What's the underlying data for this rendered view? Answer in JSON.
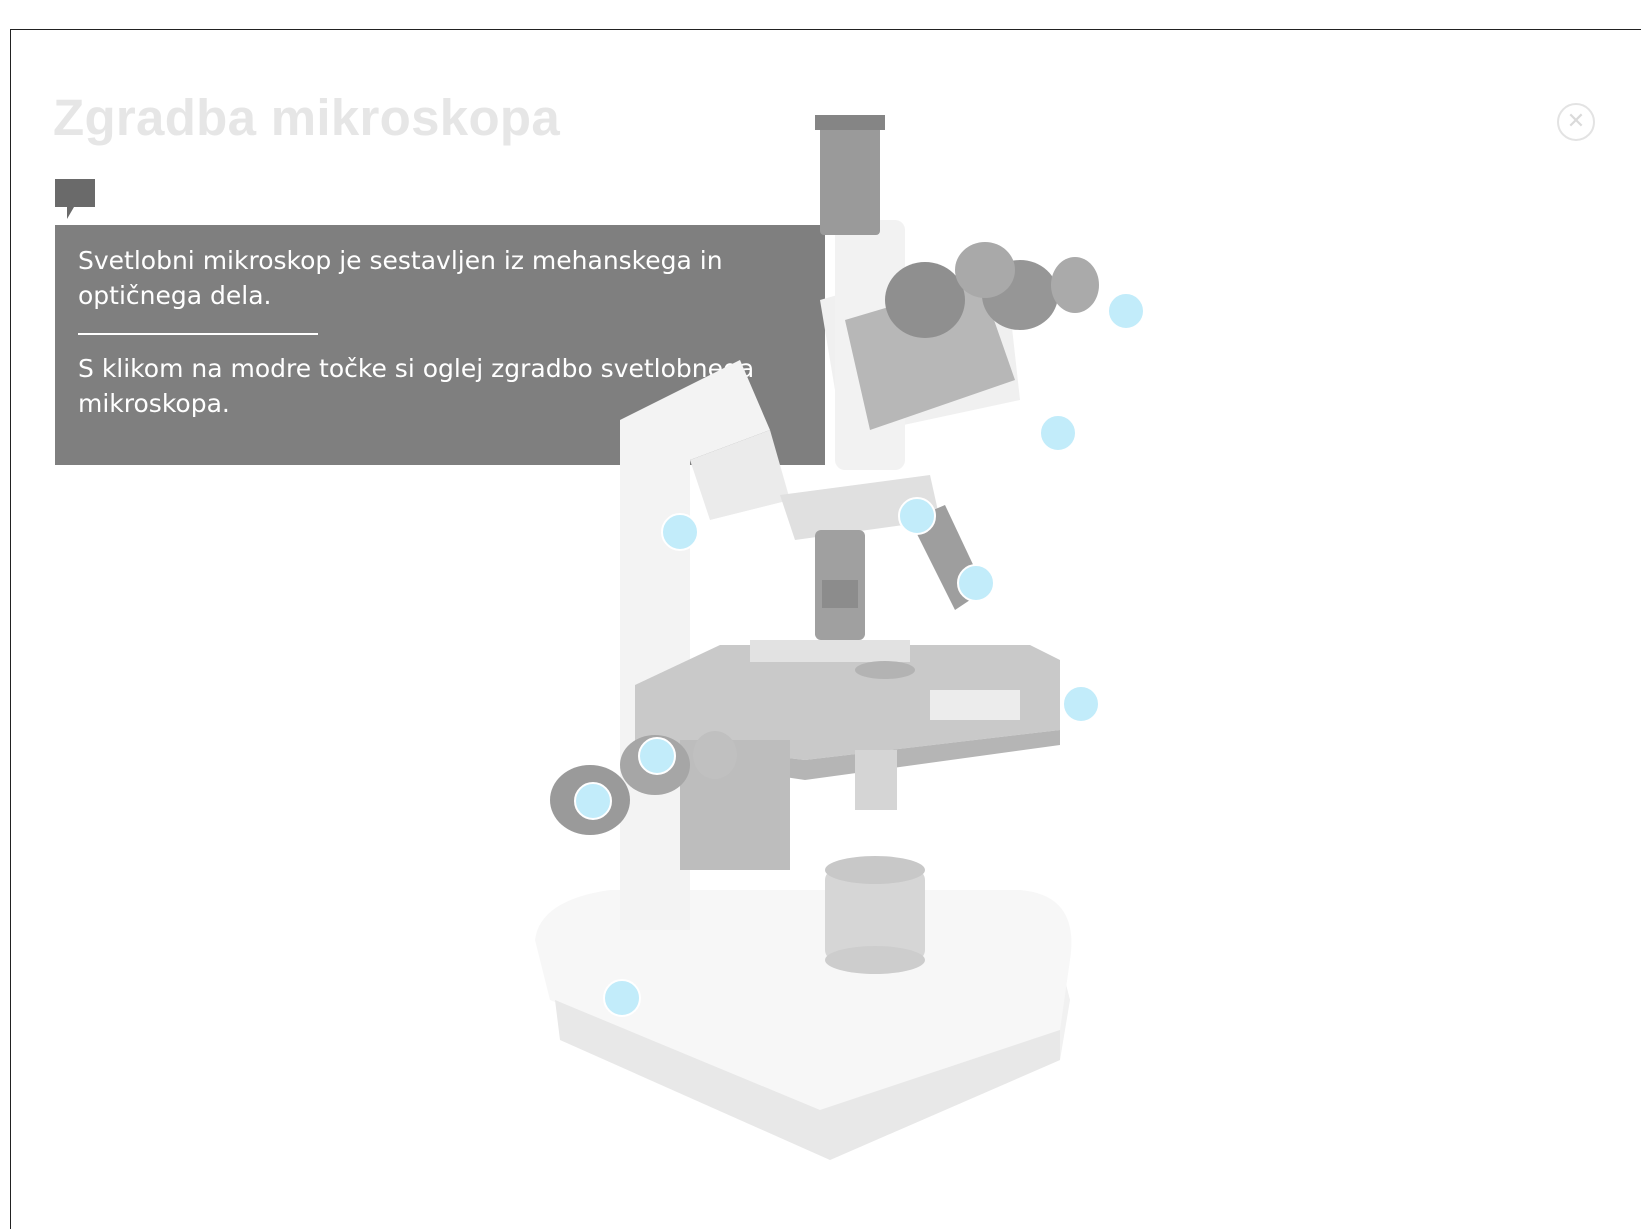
{
  "page": {
    "title": "Zgradba mikroskopa",
    "close_icon": "close-circle-icon",
    "comment_icon": "speech-bubble-icon"
  },
  "info": {
    "intro": "Svetlobni mikroskop je sestavljen iz mehanskega in optičnega dela.",
    "instruction": "S klikom na modre točke si oglej zgradbo svetlobnega mikroskopa."
  },
  "colors": {
    "hotspot": "#c2ecfa",
    "info_box": "#7f7f7f",
    "title": "#e6e6e6"
  },
  "hotspots_count": 10
}
